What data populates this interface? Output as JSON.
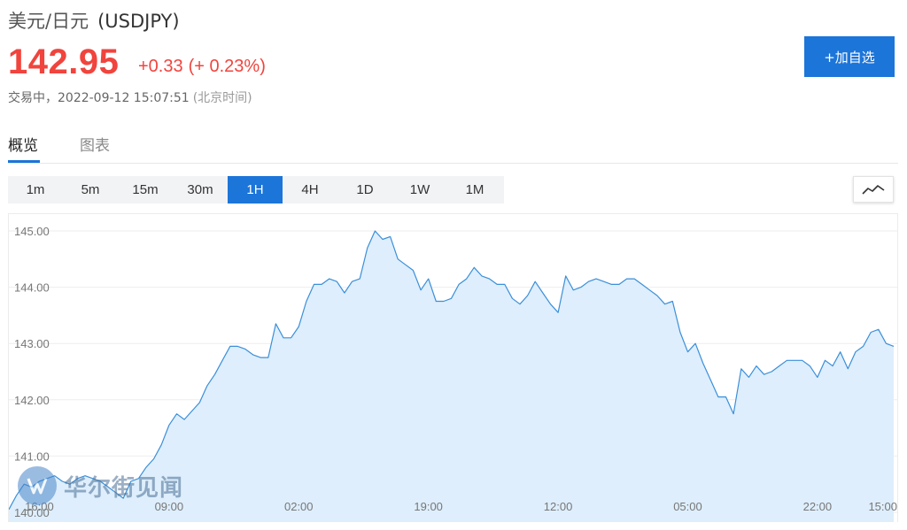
{
  "header": {
    "pair_name": "美元/日元",
    "symbol": "(USDJPY)",
    "price": "142.95",
    "change": "+0.33",
    "change_percent": "(+ 0.23%)",
    "status_label": "交易中，",
    "timestamp": "2022-09-12 15:07:51",
    "timezone": "(北京时间)",
    "add_watchlist_label": "+加自选"
  },
  "tabs": [
    {
      "label": "概览",
      "active": true
    },
    {
      "label": "图表",
      "active": false
    }
  ],
  "periods": [
    {
      "label": "1m",
      "active": false
    },
    {
      "label": "5m",
      "active": false
    },
    {
      "label": "15m",
      "active": false
    },
    {
      "label": "30m",
      "active": false
    },
    {
      "label": "1H",
      "active": true
    },
    {
      "label": "4H",
      "active": false
    },
    {
      "label": "1D",
      "active": false
    },
    {
      "label": "1W",
      "active": false
    },
    {
      "label": "1M",
      "active": false
    }
  ],
  "chart_type_icon": "line-chart-icon",
  "watermark": {
    "text": "华尔街见闻",
    "icon": "wallstreetcn-logo-icon"
  },
  "colors": {
    "accent": "#1c75d9",
    "up": "#f0443d",
    "line": "#3b8fd9",
    "area": "#deeefc"
  },
  "chart_data": {
    "type": "area",
    "title": "",
    "xlabel": "",
    "ylabel": "",
    "ylim": [
      140.0,
      145.3
    ],
    "y_ticks": [
      "145.00",
      "144.00",
      "143.00",
      "142.00",
      "141.00",
      "140.00"
    ],
    "y_tick_values": [
      145.0,
      144.0,
      143.0,
      142.0,
      141.0,
      140.0
    ],
    "x_tick_labels": [
      "16:00",
      "09:00",
      "02:00",
      "19:00",
      "12:00",
      "05:00",
      "22:00",
      "15:00"
    ],
    "x_tick_index": [
      4,
      21,
      38,
      55,
      72,
      89,
      106,
      123
    ],
    "grid": true,
    "series": [
      {
        "values": [
          140.05,
          140.3,
          140.5,
          140.45,
          140.55,
          140.6,
          140.65,
          140.55,
          140.5,
          140.6,
          140.65,
          140.6,
          140.55,
          140.45,
          140.35,
          140.25,
          140.55,
          140.6,
          140.8,
          140.95,
          141.2,
          141.55,
          141.75,
          141.65,
          141.8,
          141.95,
          142.25,
          142.45,
          142.7,
          142.95,
          142.95,
          142.9,
          142.8,
          142.75,
          142.75,
          143.35,
          143.1,
          143.1,
          143.3,
          143.75,
          144.05,
          144.05,
          144.15,
          144.1,
          143.9,
          144.1,
          144.15,
          144.7,
          145.0,
          144.85,
          144.9,
          144.5,
          144.4,
          144.3,
          143.95,
          144.15,
          143.75,
          143.75,
          143.8,
          144.05,
          144.15,
          144.35,
          144.2,
          144.15,
          144.05,
          144.05,
          143.8,
          143.7,
          143.85,
          144.1,
          143.9,
          143.7,
          143.55,
          144.2,
          143.95,
          144.0,
          144.1,
          144.15,
          144.1,
          144.05,
          144.05,
          144.15,
          144.15,
          144.05,
          143.95,
          143.85,
          143.7,
          143.75,
          143.2,
          142.85,
          143.0,
          142.65,
          142.35,
          142.05,
          142.05,
          141.75,
          142.55,
          142.4,
          142.6,
          142.45,
          142.5,
          142.6,
          142.7,
          142.7,
          142.7,
          142.6,
          142.4,
          142.7,
          142.6,
          142.85,
          142.55,
          142.85,
          142.95,
          143.2,
          143.25,
          143.0,
          142.95
        ]
      }
    ]
  }
}
